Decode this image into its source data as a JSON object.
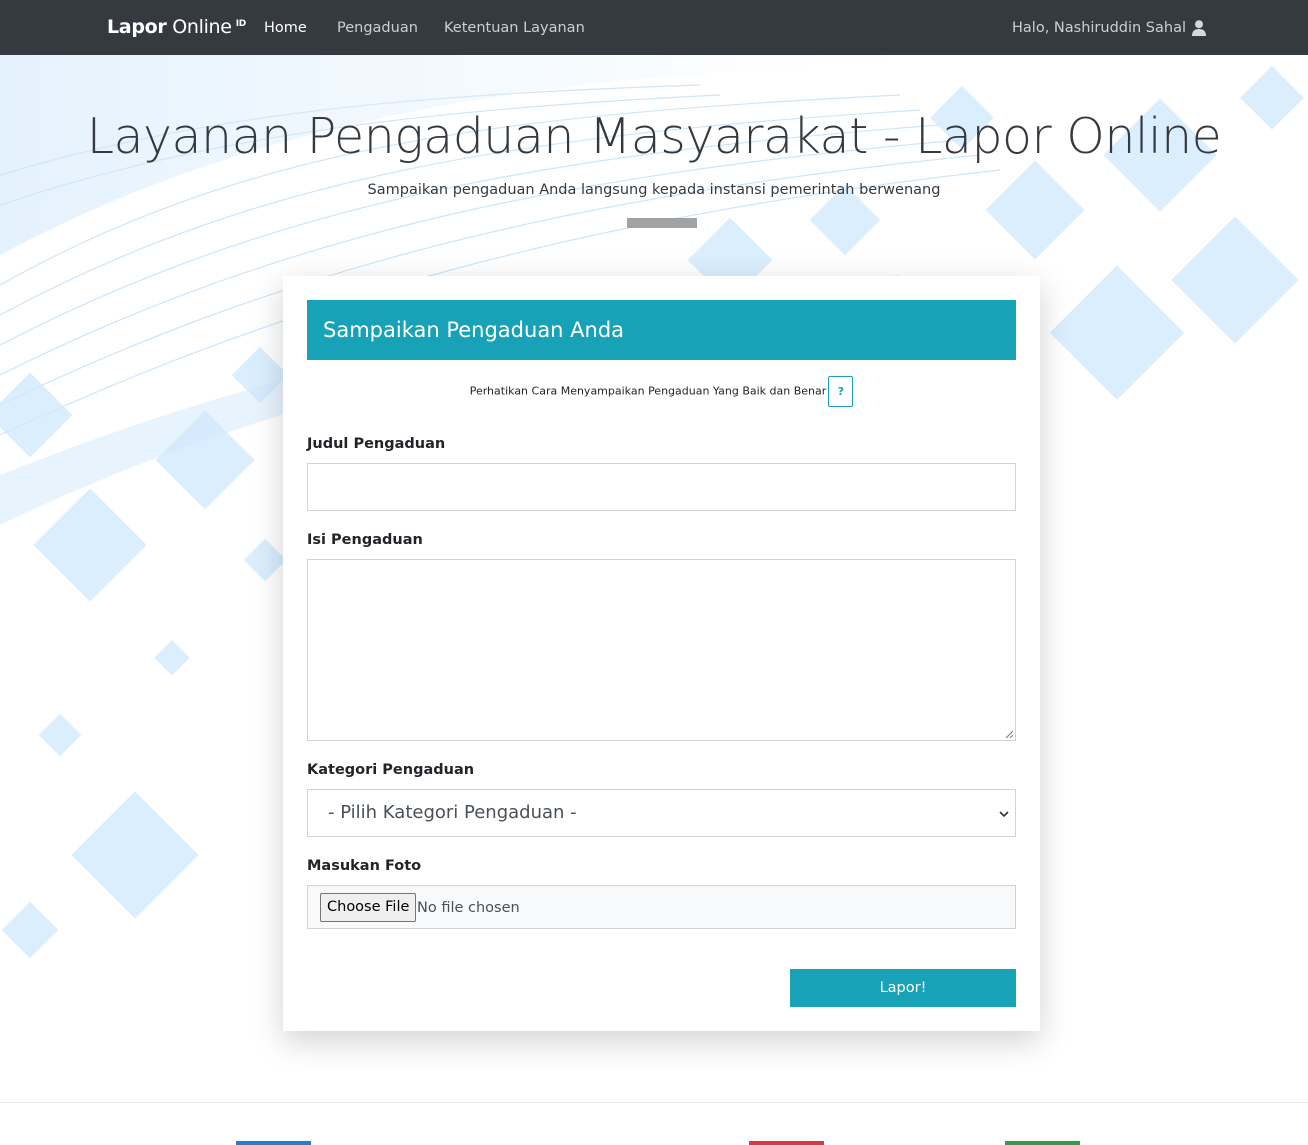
{
  "navbar": {
    "brand": {
      "bold": "Lapor",
      "light": "Online",
      "sup": "ID"
    },
    "links": [
      {
        "label": "Home",
        "active": true
      },
      {
        "label": "Pengaduan",
        "active": false
      },
      {
        "label": "Ketentuan Layanan",
        "active": false
      }
    ],
    "user_greeting": "Halo, Nashiruddin Sahal",
    "user_icon": "user-icon"
  },
  "hero": {
    "title": "Layanan Pengaduan Masyarakat - Lapor Online",
    "subtitle": "Sampaikan pengaduan Anda langsung kepada instansi pemerintah berwenang"
  },
  "form": {
    "header": "Sampaikan Pengaduan Anda",
    "notice": "Perhatikan Cara Menyampaikan Pengaduan Yang Baik dan Benar",
    "notice_button": "?",
    "title_label": "Judul Pengaduan",
    "title_value": "",
    "content_label": "Isi Pengaduan",
    "content_value": "",
    "category_label": "Kategori Pengaduan",
    "category_selected": "- Pilih Kategori Pengaduan -",
    "photo_label": "Masukan Foto",
    "file_button": "Choose File",
    "file_status": "No file chosen",
    "submit_label": "Lapor!"
  },
  "colors": {
    "navbar_bg": "#343a40",
    "accent": "#17a2b8",
    "footer_accents": [
      "#1e7fd6",
      "#d63a45",
      "#2aa14b"
    ]
  }
}
